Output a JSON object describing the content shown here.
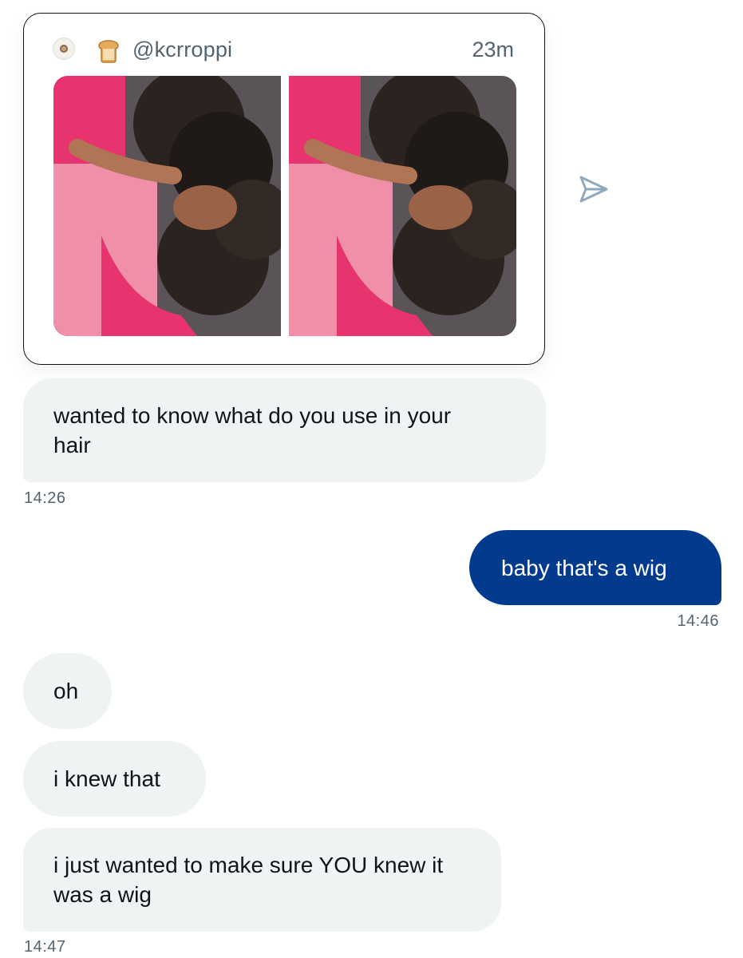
{
  "shared_post": {
    "handle": "@kcrroppi",
    "age": "23m",
    "author_emoji": "bread-emoji-icon",
    "media": [
      "photo-1",
      "photo-2"
    ]
  },
  "messages": [
    {
      "direction": "in",
      "text": "wanted to know what do you use in your hair",
      "timestamp": "14:26"
    },
    {
      "direction": "out",
      "text": "baby that's a wig",
      "timestamp": "14:46"
    },
    {
      "direction": "in",
      "text": "oh"
    },
    {
      "direction": "in",
      "text": "i knew that"
    },
    {
      "direction": "in",
      "text": "i just wanted to make sure YOU knew it was a wig",
      "timestamp": "14:47"
    }
  ],
  "colors": {
    "incoming_bubble": "#eff3f4",
    "outgoing_bubble": "#023a8e",
    "secondary_text": "#536471"
  }
}
